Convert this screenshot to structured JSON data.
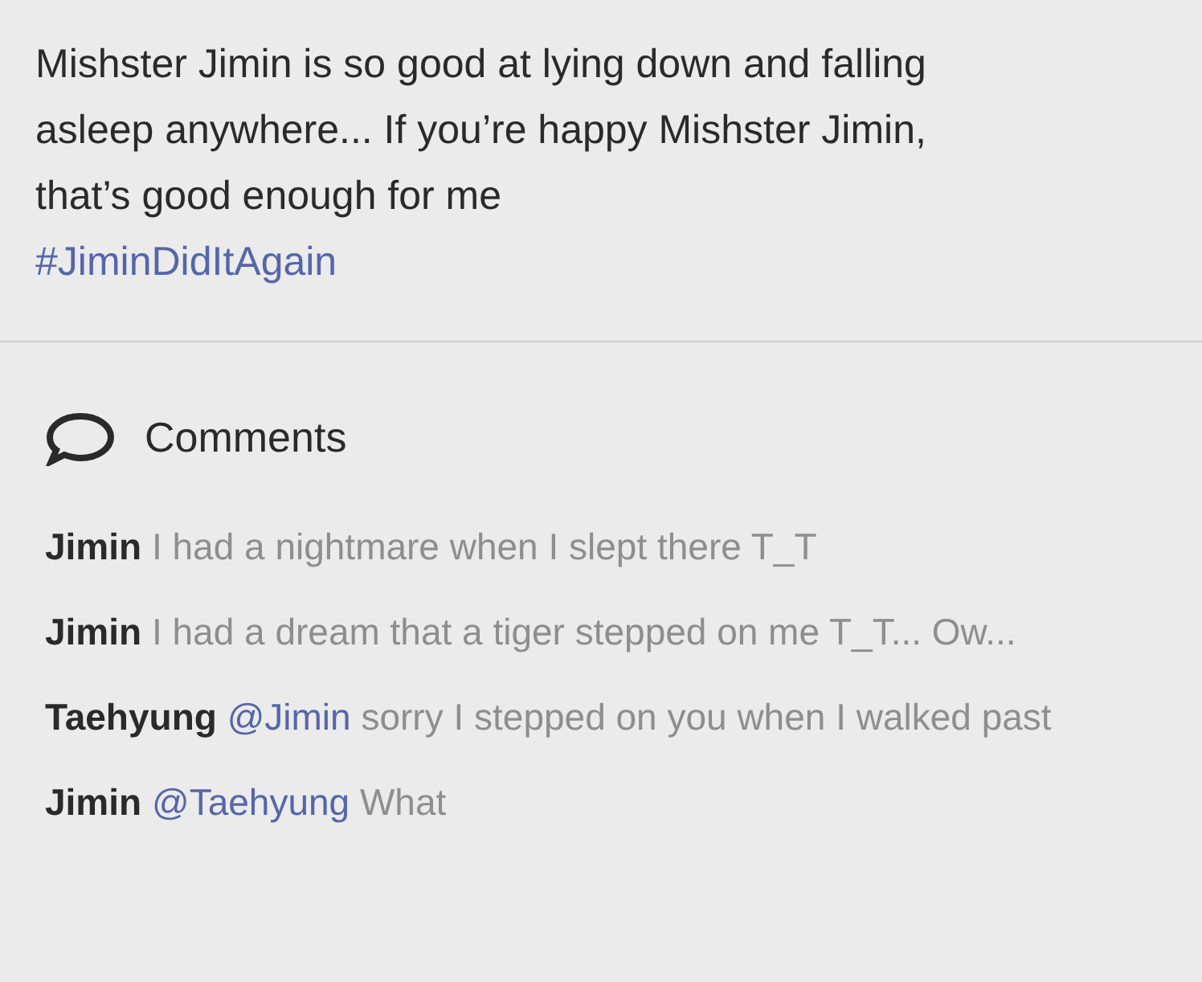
{
  "post": {
    "lines": [
      "Mishster Jimin is so good at lying down and falling",
      "asleep anywhere... If you’re happy Mishster Jimin,",
      "that’s good enough for me"
    ],
    "hashtag": "#JiminDidItAgain"
  },
  "comments": {
    "title": "Comments",
    "items": [
      {
        "author": "Jimin",
        "text": "I had a nightmare when I slept there T_T"
      },
      {
        "author": "Jimin",
        "text": "I had a dream that a tiger stepped on me T_T... Ow..."
      },
      {
        "author": "Taehyung",
        "mention": "@Jimin",
        "text": "sorry I stepped on you when I walked past"
      },
      {
        "author": "Jimin",
        "mention": "@Taehyung",
        "text": "What"
      }
    ]
  }
}
